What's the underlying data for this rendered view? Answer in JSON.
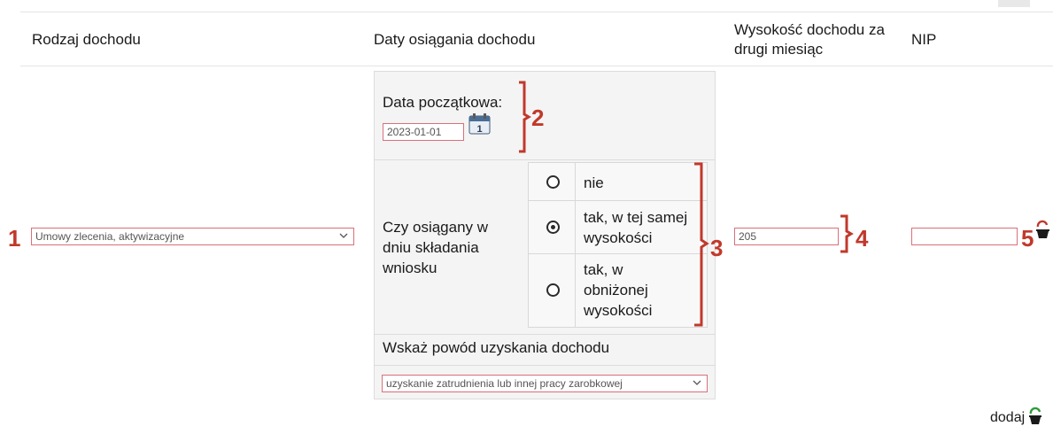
{
  "headers": {
    "income_type": "Rodzaj dochodu",
    "income_dates": "Daty osiągania dochodu",
    "income_amount_line1": "Wysokość dochodu za",
    "income_amount_line2": "drugi miesiąc",
    "nip": "NIP"
  },
  "row": {
    "income_type_value": "Umowy zlecenia, aktywizacyjne",
    "start_date_label": "Data początkowa:",
    "start_date_value": "2023-01-01",
    "calendar_day": "1",
    "achieved_label_lines": [
      "Czy osiągany w",
      "dniu składania",
      "wniosku"
    ],
    "options": [
      {
        "lines": [
          "nie"
        ],
        "checked": false
      },
      {
        "lines": [
          "tak, w tej samej",
          "wysokości"
        ],
        "checked": true
      },
      {
        "lines": [
          "tak, w",
          "obniżonej",
          "wysokości"
        ],
        "checked": false
      }
    ],
    "reason_label": "Wskaż powód uzyskania dochodu",
    "reason_value": "uzyskanie zatrudnienia lub innej pracy zarobkowej",
    "amount_value": "205",
    "nip_value": ""
  },
  "add_link": "dodaj",
  "annotations": [
    "1",
    "2",
    "3",
    "4",
    "5"
  ],
  "colors": {
    "annotation": "#c0392b",
    "field_border": "#d9707a",
    "icon_green": "#2e9b3a"
  },
  "icons": {
    "calendar": "calendar-icon",
    "delete": "delete-row-icon",
    "add": "add-row-icon"
  }
}
